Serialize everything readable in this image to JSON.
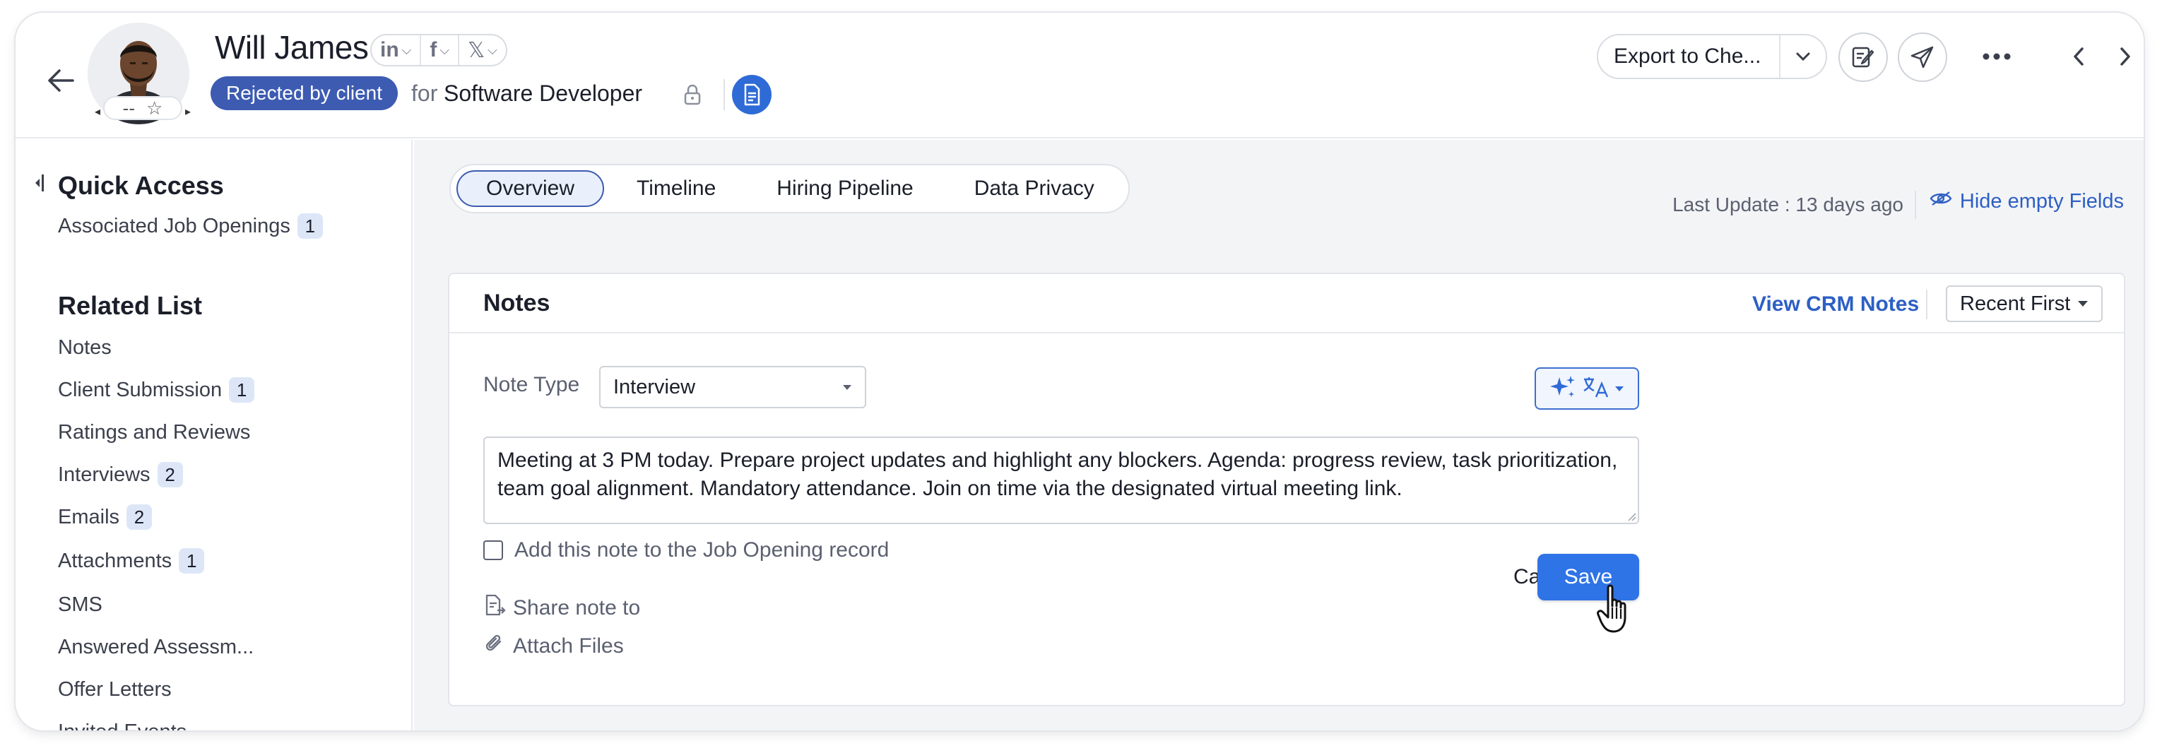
{
  "header": {
    "candidate_name": "Will James",
    "rating_text": "--",
    "status_badge": "Rejected by client",
    "for_label": "for",
    "job_title": "Software Developer",
    "export_label": "Export to Che...",
    "social": [
      "in",
      "f",
      "𝕏"
    ]
  },
  "sidebar": {
    "quick_access_heading": "Quick Access",
    "quick_access_items": [
      {
        "label": "Associated Job Openings",
        "count": "1"
      }
    ],
    "related_heading": "Related List",
    "related_items": [
      {
        "label": "Notes",
        "count": ""
      },
      {
        "label": "Client Submission",
        "count": "1"
      },
      {
        "label": "Ratings and Reviews",
        "count": ""
      },
      {
        "label": "Interviews",
        "count": "2"
      },
      {
        "label": "Emails",
        "count": "2"
      },
      {
        "label": "Attachments",
        "count": "1"
      },
      {
        "label": "SMS",
        "count": ""
      },
      {
        "label": "Answered Assessm...",
        "count": ""
      },
      {
        "label": "Offer Letters",
        "count": ""
      },
      {
        "label": "Invited Events",
        "count": ""
      }
    ]
  },
  "tabs": [
    "Overview",
    "Timeline",
    "Hiring Pipeline",
    "Data Privacy"
  ],
  "main": {
    "last_update": "Last Update : 13 days ago",
    "hide_empty": "Hide empty Fields"
  },
  "notes": {
    "title": "Notes",
    "view_crm": "View CRM Notes",
    "sort_value": "Recent First",
    "note_type_label": "Note Type",
    "note_type_value": "Interview",
    "note_text": "Meeting at 3 PM today. Prepare project updates and highlight any blockers. Agenda: progress review, task prioritization, team goal alignment. Mandatory attendance. Join on time via the designated virtual meeting link.",
    "add_to_job": "Add this note to the Job Opening record",
    "cancel": "Cancel",
    "save": "Save",
    "share_note": "Share note to",
    "attach_files": "Attach Files"
  },
  "colors": {
    "status_badge_bg": "#3d5bb1",
    "accent_blue": "#2d5fc4",
    "save_button": "#2f74e6",
    "count_badge_bg": "#dde6f7"
  }
}
